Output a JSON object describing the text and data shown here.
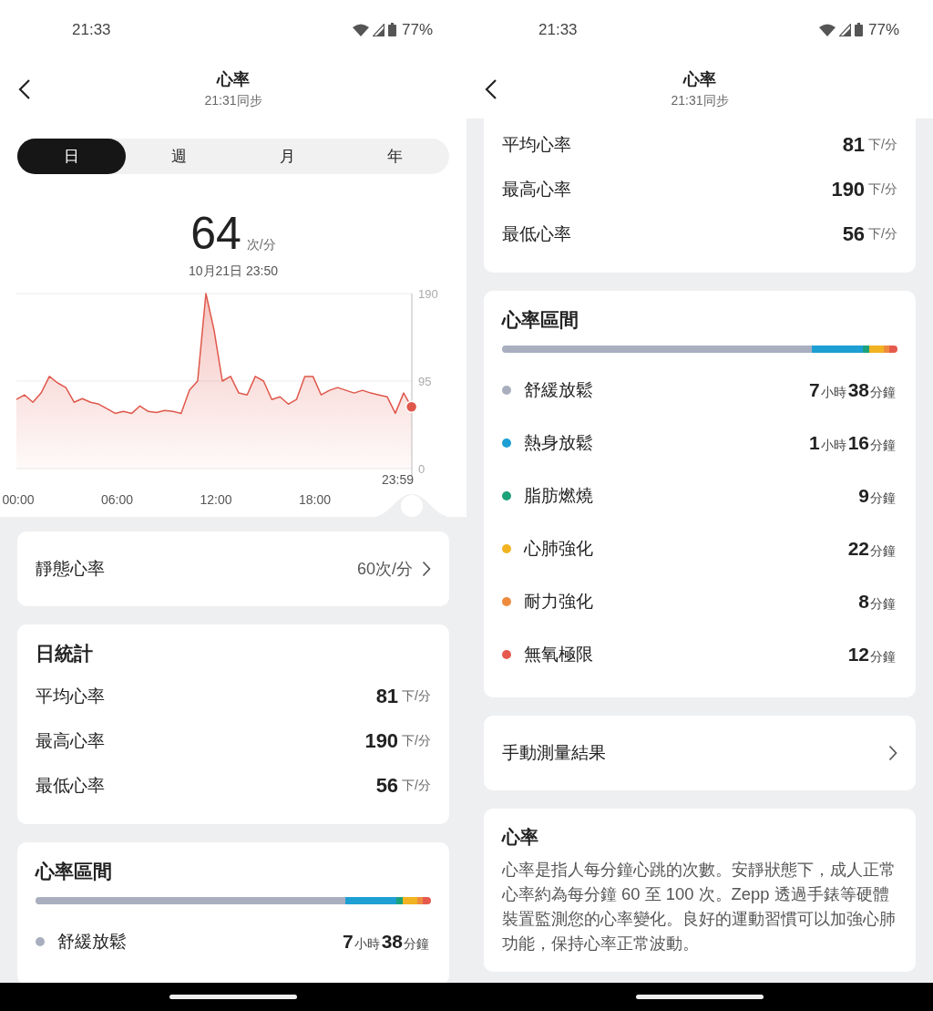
{
  "screens": [
    {
      "status_bar": {
        "time": "21:33",
        "battery": "77%"
      },
      "header": {
        "title": "心率",
        "subtitle": "21:31同步"
      },
      "tabs": [
        {
          "label": "日",
          "selected": true
        },
        {
          "label": "週",
          "selected": false
        },
        {
          "label": "月",
          "selected": false
        },
        {
          "label": "年",
          "selected": false
        }
      ],
      "reading": {
        "value": "64",
        "unit": "次/分",
        "timestamp": "10月21日 23:50"
      },
      "chart_data": {
        "type": "area",
        "x": [
          0,
          0.5,
          1,
          1.5,
          2,
          2.5,
          3,
          3.5,
          4,
          4.5,
          5,
          5.5,
          6,
          6.5,
          7,
          7.5,
          8,
          8.5,
          9,
          9.5,
          10,
          10.5,
          11,
          11.5,
          12,
          12.5,
          13,
          13.5,
          14,
          14.5,
          15,
          15.5,
          16,
          16.5,
          17,
          17.5,
          18,
          18.5,
          19,
          19.5,
          20,
          20.5,
          21,
          21.5,
          22,
          22.5,
          23,
          23.5,
          23.98
        ],
        "series": [
          {
            "color": "#e0574b",
            "values": [
              75,
              80,
              72,
              82,
              100,
              93,
              88,
              72,
              76,
              72,
              70,
              65,
              60,
              62,
              60,
              68,
              62,
              61,
              63,
              62,
              60,
              85,
              95,
              190,
              150,
              95,
              100,
              82,
              80,
              100,
              95,
              75,
              78,
              70,
              75,
              100,
              100,
              80,
              85,
              88,
              85,
              82,
              85,
              82,
              80,
              78,
              60,
              82,
              67
            ]
          }
        ],
        "xlim": [
          0,
          24
        ],
        "ylim": [
          0,
          190
        ],
        "yticks": [
          0,
          95,
          190
        ],
        "xticks": [
          {
            "value": 0,
            "label": "00:00"
          },
          {
            "value": 6,
            "label": "06:00"
          },
          {
            "value": 12,
            "label": "12:00"
          },
          {
            "value": 18,
            "label": "18:00"
          }
        ]
      },
      "chart_cursor_time": "23:59",
      "resting": {
        "label": "靜態心率",
        "value": "60次/分"
      },
      "daily_stats": {
        "title": "日統計",
        "rows": [
          {
            "label": "平均心率",
            "value": "81",
            "unit": "下/分"
          },
          {
            "label": "最高心率",
            "value": "190",
            "unit": "下/分"
          },
          {
            "label": "最低心率",
            "value": "56",
            "unit": "下/分"
          }
        ]
      },
      "zones": {
        "title": "心率區間",
        "bar": [
          {
            "color": "#a9afbf"
          },
          {
            "color": "#1d9fd4"
          },
          {
            "color": "#1ca27a"
          },
          {
            "color": "#f1b321"
          },
          {
            "color": "#ee8b3e"
          },
          {
            "color": "#e65a4e"
          }
        ],
        "items": [
          {
            "name": "舒緩放鬆",
            "color": "#a9afbf",
            "duration": [
              {
                "value": "7",
                "unit": "小時"
              },
              {
                "value": "38",
                "unit": "分鐘"
              }
            ]
          }
        ]
      }
    },
    {
      "status_bar": {
        "time": "21:33",
        "battery": "77%"
      },
      "header": {
        "title": "心率",
        "subtitle": "21:31同步"
      },
      "daily_stats": {
        "rows": [
          {
            "label": "平均心率",
            "value": "81",
            "unit": "下/分"
          },
          {
            "label": "最高心率",
            "value": "190",
            "unit": "下/分"
          },
          {
            "label": "最低心率",
            "value": "56",
            "unit": "下/分"
          }
        ]
      },
      "zones": {
        "title": "心率區間",
        "bar": [
          {
            "color": "#a9afbf"
          },
          {
            "color": "#1d9fd4"
          },
          {
            "color": "#1ca27a"
          },
          {
            "color": "#f1b321"
          },
          {
            "color": "#ee8b3e"
          },
          {
            "color": "#e65a4e"
          }
        ],
        "items": [
          {
            "name": "舒緩放鬆",
            "color": "#a9afbf",
            "duration": [
              {
                "value": "7",
                "unit": "小時"
              },
              {
                "value": "38",
                "unit": "分鐘"
              }
            ]
          },
          {
            "name": "熱身放鬆",
            "color": "#1d9fd4",
            "duration": [
              {
                "value": "1",
                "unit": "小時"
              },
              {
                "value": "16",
                "unit": "分鐘"
              }
            ]
          },
          {
            "name": "脂肪燃燒",
            "color": "#1ca27a",
            "duration": [
              {
                "value": "9",
                "unit": "分鐘"
              }
            ]
          },
          {
            "name": "心肺強化",
            "color": "#f1b321",
            "duration": [
              {
                "value": "22",
                "unit": "分鐘"
              }
            ]
          },
          {
            "name": "耐力強化",
            "color": "#ee8b3e",
            "duration": [
              {
                "value": "8",
                "unit": "分鐘"
              }
            ]
          },
          {
            "name": "無氧極限",
            "color": "#e65a4e",
            "duration": [
              {
                "value": "12",
                "unit": "分鐘"
              }
            ]
          }
        ]
      },
      "manual": {
        "label": "手動測量結果"
      },
      "info": {
        "title": "心率",
        "text": "心率是指人每分鐘心跳的次數。安靜狀態下，成人正常心率約為每分鐘 60 至 100 次。Zepp 透過手錶等硬體裝置監測您的心率變化。良好的運動習慣可以加強心肺功能，保持心率正常波動。"
      }
    }
  ]
}
